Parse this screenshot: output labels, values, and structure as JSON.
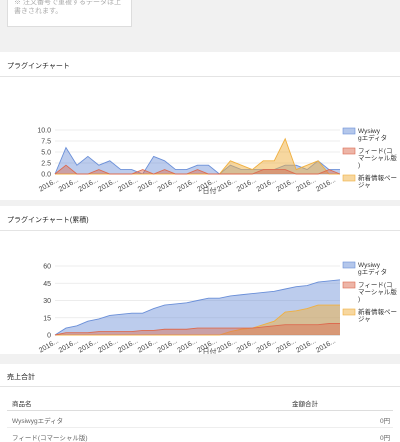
{
  "notice": {
    "text": "※ 注文番号で重複するデータは上書きされます。"
  },
  "plugin_chart": {
    "title": "プラグインチャート",
    "chart_data": {
      "type": "area",
      "x_tick_labels": [
        "2016...",
        "2016...",
        "2016...",
        "2016...",
        "2016...",
        "2016...",
        "2016...",
        "2016...",
        "2016...",
        "2016...",
        "2016...",
        "2016...",
        "2016...",
        "2016...",
        "2016..."
      ],
      "xlabel": "日付",
      "ylabel": "",
      "ylim": [
        0,
        10
      ],
      "yticks": [
        "0.0",
        "2.5",
        "5.0",
        "7.5",
        "10.0"
      ],
      "grid": true,
      "legend_position": "right",
      "series": [
        {
          "name": "Wysiwygエディタ",
          "color": "#6a8fd8",
          "values": [
            0,
            6,
            2,
            4,
            2,
            3,
            1,
            1,
            0,
            4,
            3,
            1,
            1,
            2,
            2,
            0,
            2,
            1,
            1,
            1,
            1,
            2,
            2,
            1,
            3,
            1,
            1
          ]
        },
        {
          "name": "フィード(コマーシャル版)",
          "color": "#dc6b50",
          "values": [
            0,
            2,
            0,
            0,
            1,
            0,
            0,
            0,
            1,
            0,
            1,
            0,
            0,
            1,
            0,
            0,
            0,
            0,
            0,
            1,
            1,
            1,
            0,
            0,
            0,
            1,
            0
          ]
        },
        {
          "name": "新着情報ページャ",
          "color": "#f0b040",
          "values": [
            0,
            0,
            0,
            0,
            0,
            0,
            0,
            0,
            0,
            0,
            0,
            0,
            0,
            0,
            0,
            0,
            3,
            2,
            1,
            3,
            3,
            8,
            1,
            2,
            3,
            0,
            0
          ]
        }
      ]
    }
  },
  "cumulative_chart": {
    "title": "プラグインチャート(累積)",
    "chart_data": {
      "type": "area",
      "x_tick_labels": [
        "2016...",
        "2016...",
        "2016...",
        "2016...",
        "2016...",
        "2016...",
        "2016...",
        "2016...",
        "2016...",
        "2016...",
        "2016...",
        "2016...",
        "2016...",
        "2016...",
        "2016..."
      ],
      "xlabel": "日付",
      "ylabel": "",
      "ylim": [
        0,
        60
      ],
      "yticks": [
        "0",
        "15",
        "30",
        "45",
        "60"
      ],
      "grid": true,
      "legend_position": "right",
      "series": [
        {
          "name": "Wysiwygエディタ",
          "color": "#6a8fd8",
          "values": [
            0,
            6,
            8,
            12,
            14,
            17,
            18,
            19,
            19,
            23,
            26,
            27,
            28,
            30,
            32,
            32,
            34,
            35,
            36,
            37,
            38,
            40,
            42,
            43,
            46,
            47,
            48
          ]
        },
        {
          "name": "フィード(コマーシャル版)",
          "color": "#dc6b50",
          "values": [
            0,
            2,
            2,
            2,
            3,
            3,
            3,
            3,
            4,
            4,
            5,
            5,
            5,
            6,
            6,
            6,
            6,
            6,
            6,
            7,
            8,
            9,
            9,
            9,
            9,
            10,
            10
          ]
        },
        {
          "name": "新着情報ページャ",
          "color": "#f0b040",
          "values": [
            0,
            0,
            0,
            0,
            0,
            0,
            0,
            0,
            0,
            0,
            0,
            0,
            0,
            0,
            0,
            0,
            3,
            5,
            6,
            9,
            12,
            20,
            21,
            23,
            26,
            26,
            26
          ]
        }
      ]
    }
  },
  "sales_total": {
    "title": "売上合計",
    "col_product": "商品名",
    "col_amount": "金額合計",
    "rows": [
      {
        "name": "Wysiwygエディタ",
        "amount": "0円"
      },
      {
        "name": "フィード(コマーシャル版)",
        "amount": "0円"
      }
    ]
  }
}
